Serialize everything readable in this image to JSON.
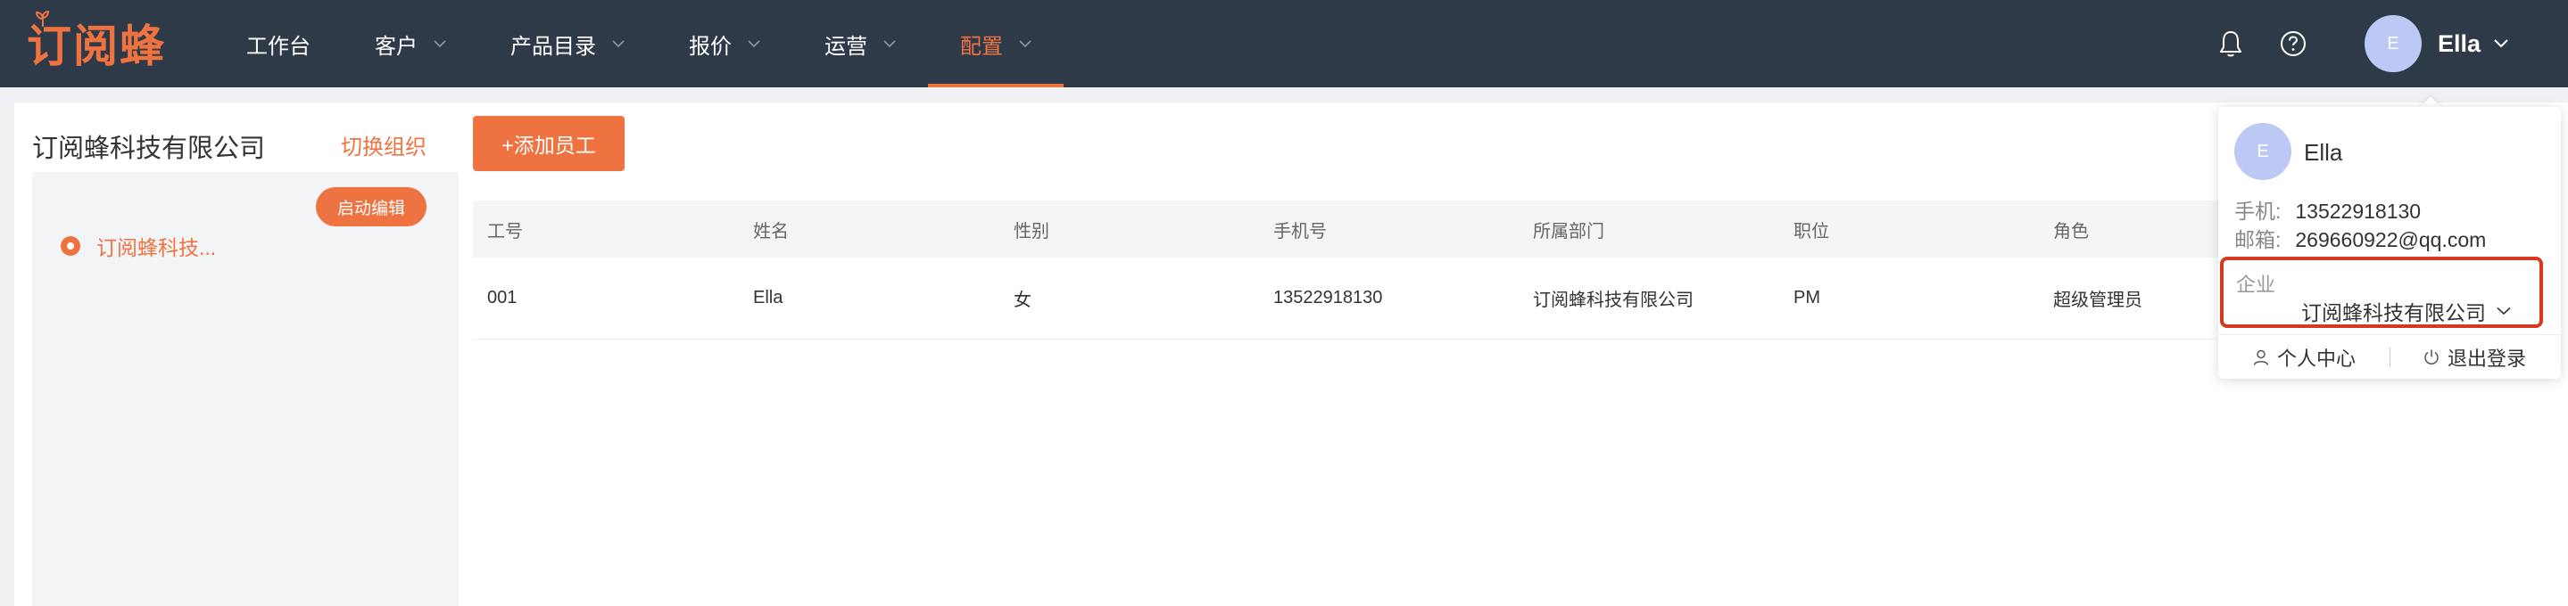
{
  "brand": {
    "logo_text": "订阅蜂",
    "accent": "#ef7341",
    "nav_bg": "#2f3a48"
  },
  "nav": {
    "items": [
      {
        "label": "工作台",
        "has_dropdown": false,
        "active": false
      },
      {
        "label": "客户",
        "has_dropdown": true,
        "active": false
      },
      {
        "label": "产品目录",
        "has_dropdown": true,
        "active": false
      },
      {
        "label": "报价",
        "has_dropdown": true,
        "active": false
      },
      {
        "label": "运营",
        "has_dropdown": true,
        "active": false
      },
      {
        "label": "配置",
        "has_dropdown": true,
        "active": true
      }
    ],
    "icons": [
      "bell-icon",
      "help-icon"
    ],
    "user": {
      "avatar_letter": "E",
      "name": "Ella"
    }
  },
  "left_panel": {
    "org_title": "订阅蜂科技有限公司",
    "switch_org_label": "切换组织",
    "edit_button_label": "启动编辑",
    "tree": [
      {
        "label": "订阅蜂科技...",
        "selected": true
      }
    ]
  },
  "main": {
    "add_button_label": "+添加员工",
    "table": {
      "columns": [
        "工号",
        "姓名",
        "性别",
        "手机号",
        "所属部门",
        "职位",
        "角色"
      ],
      "rows": [
        [
          "001",
          "Ella",
          "女",
          "13522918130",
          "订阅蜂科技有限公司",
          "PM",
          "超级管理员"
        ]
      ]
    }
  },
  "user_popover": {
    "avatar_letter": "E",
    "name": "Ella",
    "phone_label": "手机:",
    "phone": "13522918130",
    "email_label": "邮箱:",
    "email": "269660922@qq.com",
    "company_label": "企业",
    "company_value": "订阅蜂科技有限公司",
    "highlight_color": "#d9381e",
    "profile_label": "个人中心",
    "logout_label": "退出登录"
  }
}
